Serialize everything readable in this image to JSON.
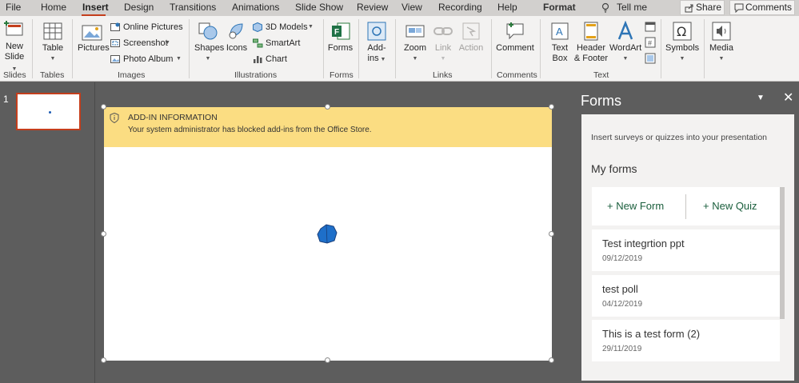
{
  "menu": {
    "tabs": [
      "File",
      "Home",
      "Insert",
      "Design",
      "Transitions",
      "Animations",
      "Slide Show",
      "Review",
      "View",
      "Recording",
      "Help",
      "Format"
    ],
    "active_tab": "Insert",
    "tell_me": "Tell me",
    "share": "Share",
    "comments": "Comments"
  },
  "ribbon": {
    "new_slide": "New",
    "new_slide_2": "Slide",
    "table": "Table",
    "pictures": "Pictures",
    "online_pictures": "Online Pictures",
    "screenshot": "Screenshot",
    "photo_album": "Photo Album",
    "shapes": "Shapes",
    "icons": "Icons",
    "models_3d": "3D Models",
    "smartart": "SmartArt",
    "chart": "Chart",
    "forms": "Forms",
    "addins": "Add-",
    "addins_2": "ins",
    "zoom": "Zoom",
    "link": "Link",
    "action": "Action",
    "comment": "Comment",
    "text_box": "Text",
    "text_box_2": "Box",
    "header_footer": "Header",
    "header_footer_2": "& Footer",
    "wordart": "WordArt",
    "symbols": "Symbols",
    "media": "Media",
    "groups": {
      "slides": "Slides",
      "tables": "Tables",
      "images": "Images",
      "illustrations": "Illustrations",
      "forms": "Forms",
      "links": "Links",
      "comments": "Comments",
      "text": "Text"
    }
  },
  "thumbnails": {
    "slide_number": "1"
  },
  "slide": {
    "info_title": "ADD-IN INFORMATION",
    "info_message": "Your system administrator has blocked add-ins from the Office Store."
  },
  "forms_pane": {
    "title": "Forms",
    "description": "Insert surveys or quizzes into your presentation",
    "my_forms": "My forms",
    "new_form": "+ New Form",
    "new_quiz": "+ New Quiz",
    "items": [
      {
        "name": "Test integrtion ppt",
        "date": "09/12/2019"
      },
      {
        "name": "test poll",
        "date": "04/12/2019"
      },
      {
        "name": "This is a test form (2)",
        "date": "29/11/2019"
      }
    ]
  },
  "colors": {
    "accent": "#c43e1c",
    "forms_green": "#1a5e3c",
    "info_yellow": "#fbdd82",
    "shape_blue": "#1e6fc9"
  }
}
